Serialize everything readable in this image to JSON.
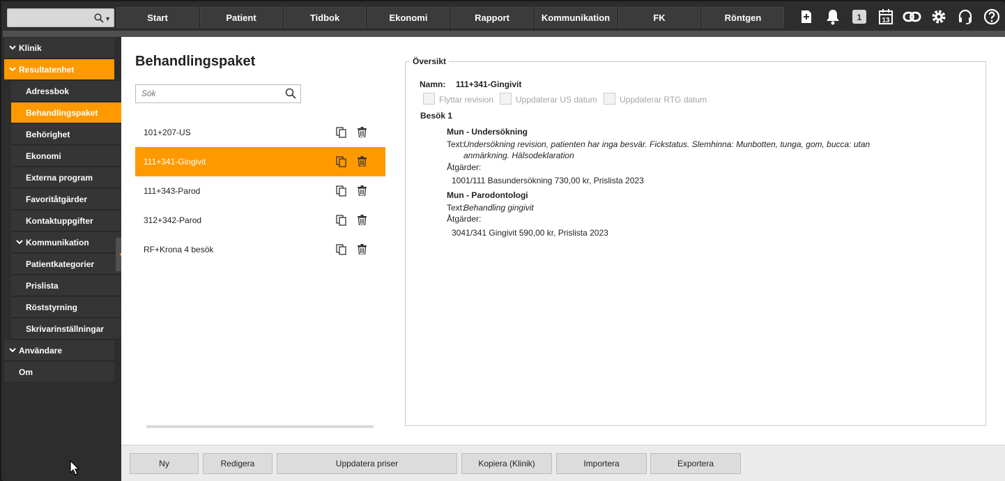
{
  "topbar": {
    "nav": [
      "Start",
      "Patient",
      "Tidbok",
      "Ekonomi",
      "Rapport",
      "Kommunikation",
      "FK",
      "Röntgen"
    ],
    "calendar_day": "13",
    "badge": "1"
  },
  "sidebar": {
    "items": [
      {
        "label": "Klinik",
        "level": "top",
        "chevron": true
      },
      {
        "label": "Resultatenhet",
        "level": "top",
        "chevron": true,
        "active": true
      },
      {
        "label": "Adressbok",
        "level": "sub"
      },
      {
        "label": "Behandlingspaket",
        "level": "sub",
        "active": true
      },
      {
        "label": "Behörighet",
        "level": "sub"
      },
      {
        "label": "Ekonomi",
        "level": "sub"
      },
      {
        "label": "Externa program",
        "level": "sub"
      },
      {
        "label": "Favoritåtgärder",
        "level": "sub"
      },
      {
        "label": "Kontaktuppgifter",
        "level": "sub"
      },
      {
        "label": "Kommunikation",
        "level": "sub",
        "chevron": true
      },
      {
        "label": "Patientkategorier",
        "level": "sub"
      },
      {
        "label": "Prislista",
        "level": "sub"
      },
      {
        "label": "Röststyrning",
        "level": "sub"
      },
      {
        "label": "Skrivarinställningar",
        "level": "sub"
      },
      {
        "label": "Användare",
        "level": "top",
        "chevron": true
      },
      {
        "label": "Om",
        "level": "top"
      }
    ]
  },
  "main": {
    "title": "Behandlingspaket",
    "search_placeholder": "Sök",
    "packages": [
      {
        "name": "101+207-US",
        "selected": false
      },
      {
        "name": "111+341-Gingivit",
        "selected": true
      },
      {
        "name": "111+343-Parod",
        "selected": false
      },
      {
        "name": "312+342-Parod",
        "selected": false
      },
      {
        "name": "RF+Krona 4 besök",
        "selected": false
      }
    ]
  },
  "overview": {
    "legend": "Översikt",
    "name_label": "Namn:",
    "name_value": "111+341-Gingivit",
    "checkboxes": [
      "Flyttar revision",
      "Uppdaterar US datum",
      "Uppdaterar RTG datum"
    ],
    "visit": "Besök 1",
    "sections": [
      {
        "heading": "Mun - Undersökning",
        "text_label": "Text:",
        "text_line1": "Undersökning revision, patienten har inga besvär. Fickstatus. Slemhinna: Munbotten, tunga, gom, bucca: utan",
        "text_line2": "anmärkning. Hälsodeklaration",
        "actions_label": "Åtgärder:",
        "action": "1001/111 Basundersökning 730,00 kr, Prislista 2023"
      },
      {
        "heading": "Mun - Parodontologi",
        "text_label": "Text:",
        "text_line1": "Behandling gingivit",
        "actions_label": "Åtgärder:",
        "action": "3041/341 Gingivit 590,00 kr, Prislista 2023"
      }
    ]
  },
  "bottom": {
    "buttons": [
      "Ny",
      "Redigera",
      "Uppdatera priser",
      "Kopiera (Klinik)",
      "Importera",
      "Exportera"
    ]
  }
}
